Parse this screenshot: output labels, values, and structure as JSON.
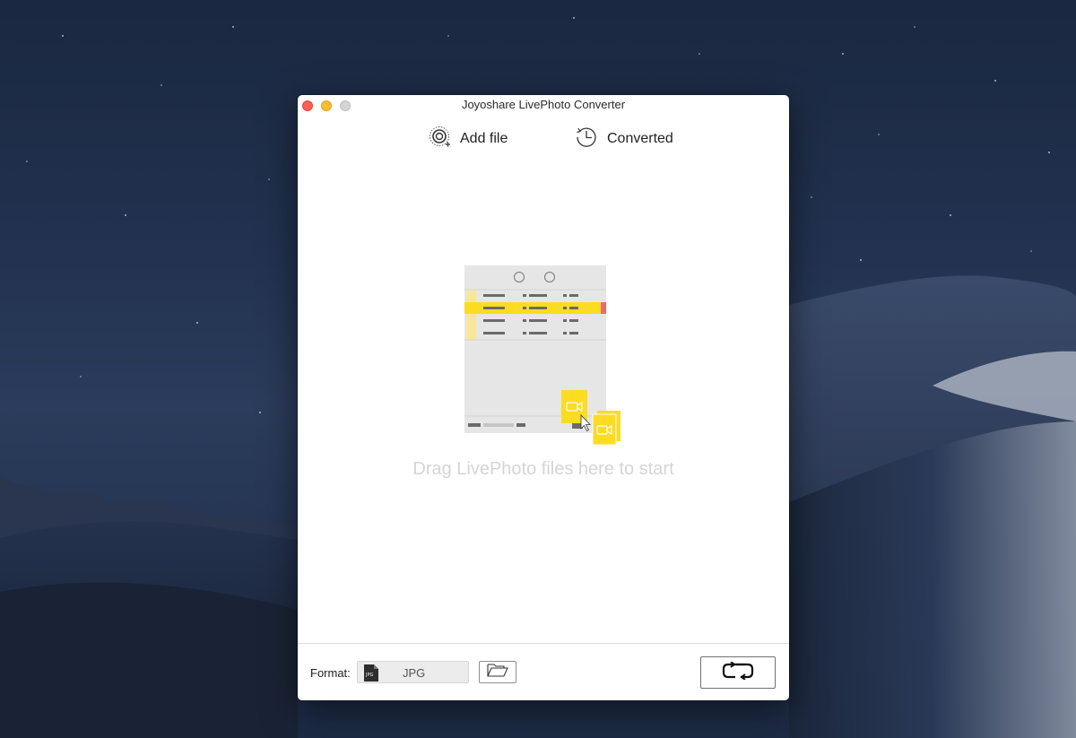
{
  "window": {
    "title": "Joyoshare LivePhoto Converter"
  },
  "toolbar": {
    "add_file_label": "Add file",
    "add_file_icon": "add-file-icon",
    "converted_label": "Converted",
    "converted_icon": "history-clock-icon"
  },
  "drop_zone": {
    "hint": "Drag LivePhoto files here to start"
  },
  "bottom_bar": {
    "format_label": "Format:",
    "format_value": "JPG",
    "format_icon_text": "JPG",
    "folder_icon": "folder-icon",
    "convert_icon": "convert-icon"
  },
  "colors": {
    "accent_yellow": "#fbdc22",
    "close": "#fd5f57",
    "minimize": "#febc2e",
    "maximize": "#d4d4d4",
    "hint_text": "#d5d5d5"
  }
}
